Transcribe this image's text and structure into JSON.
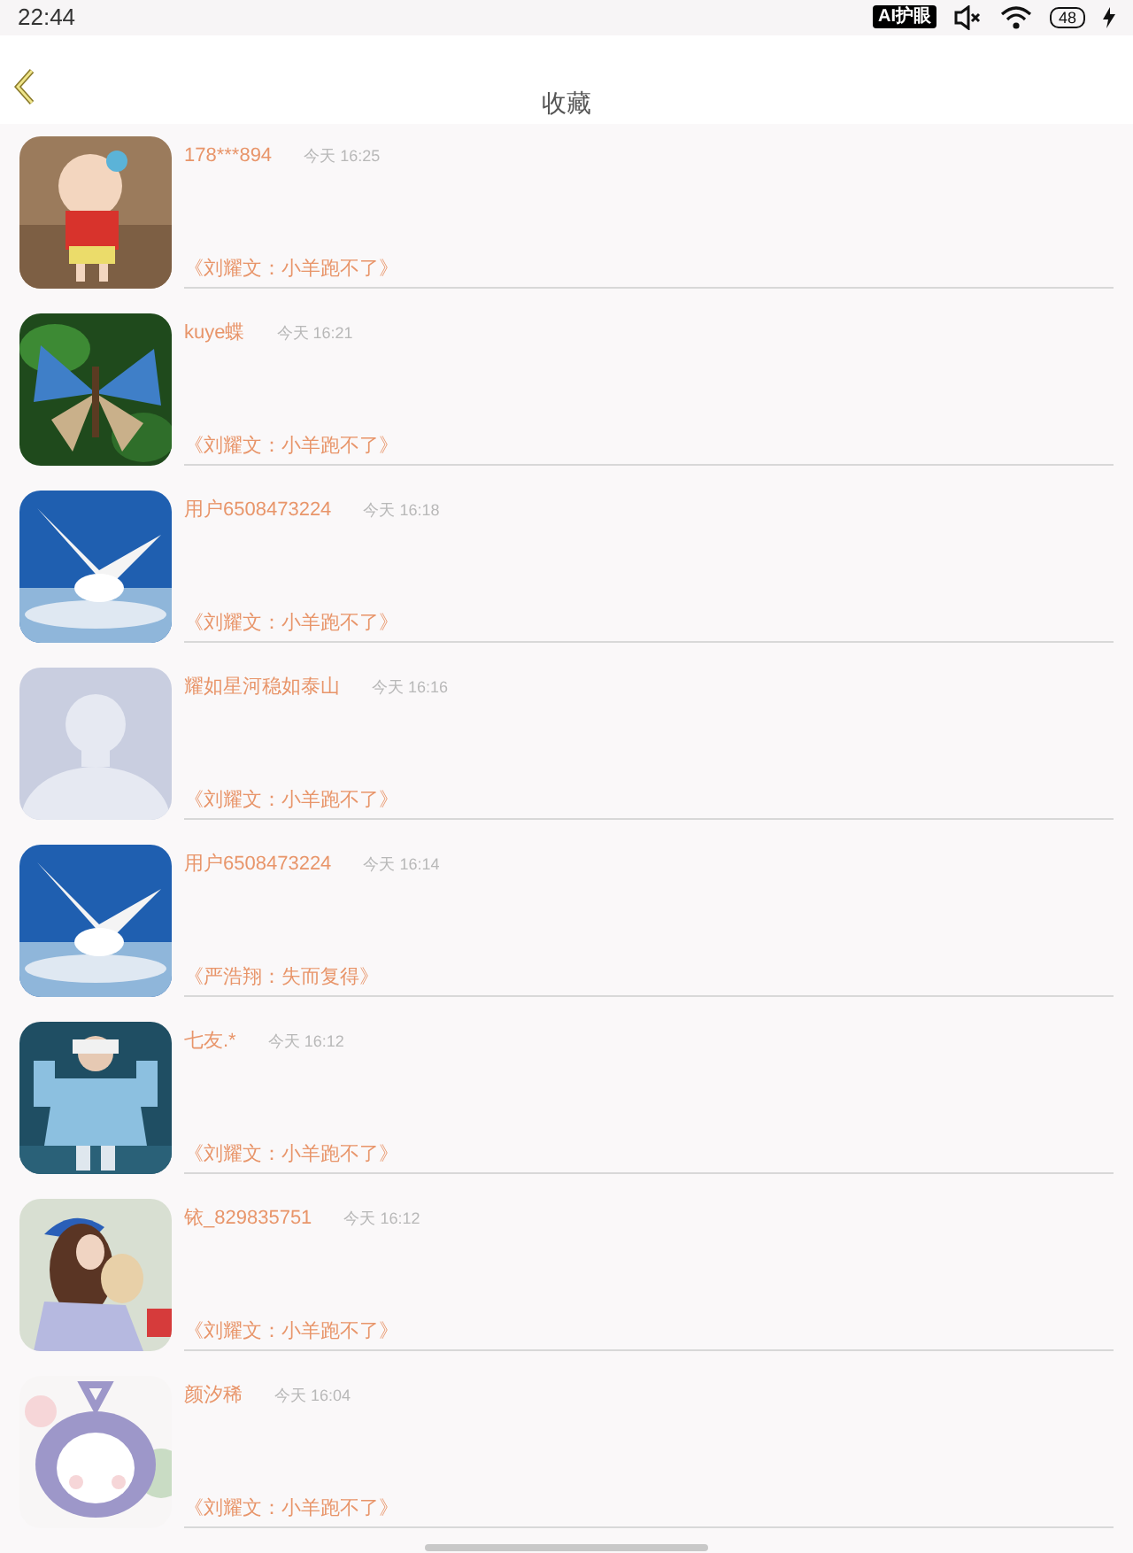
{
  "status_bar": {
    "time": "22:44",
    "badge": "AI护眼",
    "battery": "48"
  },
  "header": {
    "title": "收藏"
  },
  "items": [
    {
      "name": "178***894",
      "time": "今天 16:25",
      "work": "《刘耀文：小羊跑不了》"
    },
    {
      "name": "kuye蝶",
      "time": "今天 16:21",
      "work": "《刘耀文：小羊跑不了》"
    },
    {
      "name": "用户6508473224",
      "time": "今天 16:18",
      "work": "《刘耀文：小羊跑不了》"
    },
    {
      "name": "耀如星河稳如泰山",
      "time": "今天 16:16",
      "work": "《刘耀文：小羊跑不了》",
      "avatar": {
        "kind": "default"
      }
    },
    {
      "name": "用户6508473224",
      "time": "今天 16:14",
      "work": "《严浩翔：失而复得》"
    },
    {
      "name": "七友.*",
      "time": "今天 16:12",
      "work": "《刘耀文：小羊跑不了》"
    },
    {
      "name": "铱_829835751",
      "time": "今天 16:12",
      "work": "《刘耀文：小羊跑不了》"
    },
    {
      "name": "颜汐稀",
      "time": "今天 16:04",
      "work": "《刘耀文：小羊跑不了》"
    }
  ]
}
